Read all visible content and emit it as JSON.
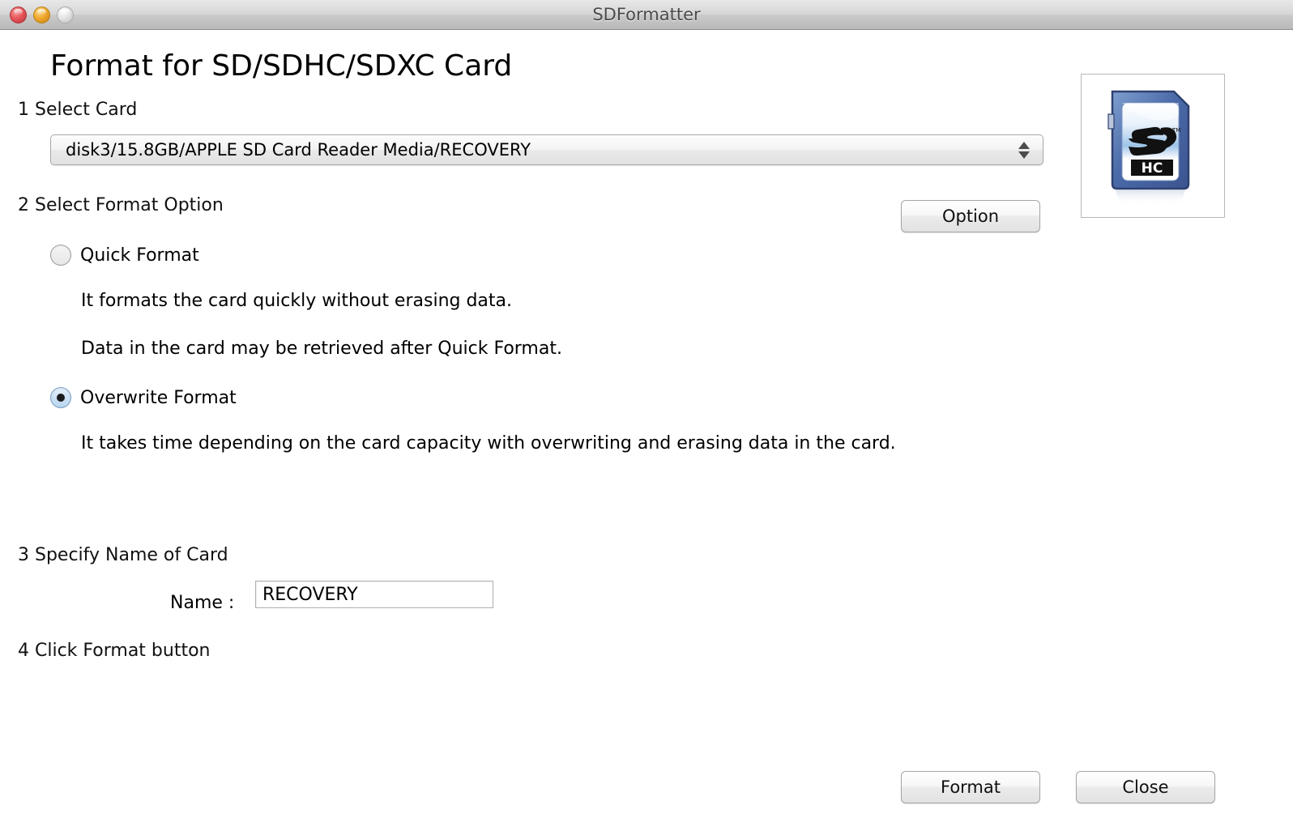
{
  "window": {
    "title": "SDFormatter",
    "controls": {
      "close": "close-button",
      "minimize": "minimize-button",
      "zoom": "zoom-button"
    }
  },
  "page": {
    "title": "Format for SD/SDHC/SDXC Card"
  },
  "steps": {
    "step1": "1 Select Card",
    "step2": "2 Select Format Option",
    "step3": "3 Specify Name of Card",
    "step4": "4 Click Format button"
  },
  "card_select": {
    "value": "disk3/15.8GB/APPLE SD Card Reader Media/RECOVERY",
    "options": [
      "disk3/15.8GB/APPLE SD Card Reader Media/RECOVERY"
    ]
  },
  "sd_logo": {
    "top_text": "SD",
    "bottom_text": "HC",
    "trademark": "TM"
  },
  "format_options": {
    "option_button": "Option",
    "quick": {
      "label": "Quick Format",
      "selected": false,
      "description_1": "It formats the card quickly without erasing data.",
      "description_2": "Data in the card may be retrieved after Quick Format."
    },
    "overwrite": {
      "label": "Overwrite Format",
      "selected": true,
      "description_1": "It takes time depending on the card capacity with overwriting and erasing data in the card."
    }
  },
  "name_field": {
    "label": "Name :",
    "value": "RECOVERY",
    "placeholder": ""
  },
  "footer": {
    "format_label": "Format",
    "close_label": "Close"
  },
  "colors": {
    "accent_blue": "#4a6fa5",
    "selected_radio_fill": "#c9e0f5",
    "window_chrome": "#d6d6d6",
    "text": "#000000"
  }
}
